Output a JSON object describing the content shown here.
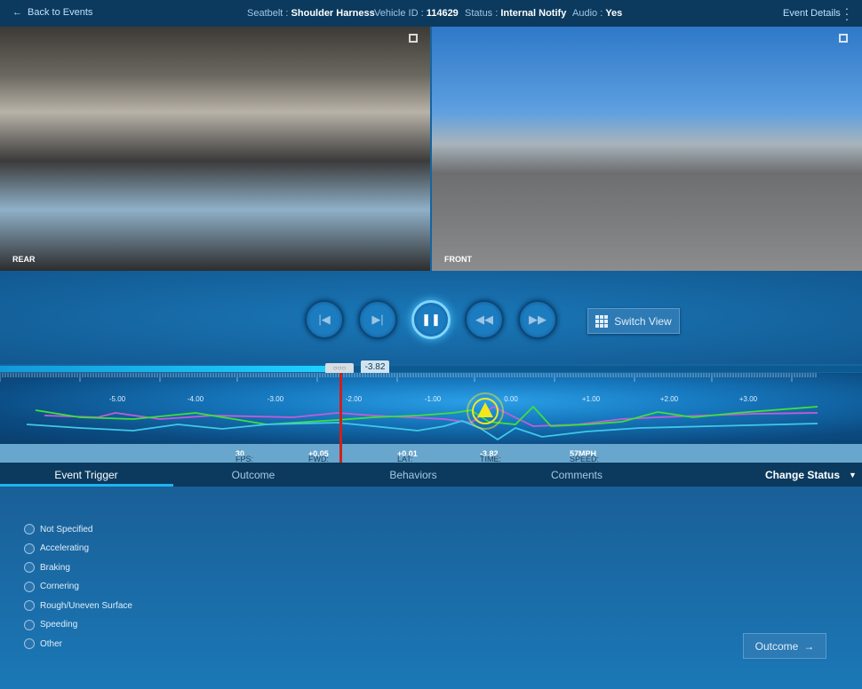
{
  "header": {
    "back_label": "Back to Events",
    "seatbelt_label": "Seatbelt :",
    "seatbelt_value": "Shoulder Harness",
    "vehicle_label": "Vehicle ID :",
    "vehicle_value": "114629",
    "status_label": "Status :",
    "status_value": "Internal Notify",
    "audio_label": "Audio :",
    "audio_value": "Yes",
    "details_label": "Event Details"
  },
  "videos": {
    "rear_label": "REAR",
    "front_label": "FRONT"
  },
  "controls": {
    "buttons": [
      "skip-back",
      "step-forward",
      "pause",
      "rewind",
      "fast-forward"
    ],
    "switch_view_label": "Switch View"
  },
  "timeline": {
    "progress_percent": 38,
    "thumb_label": "○○○",
    "current_time": "-3.82",
    "ticks": [
      "-5.00",
      "-4.00",
      "-3.00",
      "-2.00",
      "-1.00",
      "0.00",
      "+1.00",
      "+2.00",
      "+3.00"
    ],
    "series_colors": [
      "#c45cd8",
      "#3ee03a",
      "#3fc8e8"
    ],
    "playhead_color": "#d0201a",
    "event_marker_color": "#f2e81c"
  },
  "stats": {
    "fps_label": "FPS:",
    "fps": "30",
    "fwd_label": "FWD:",
    "fwd": "+0.05",
    "lat_label": "LAT:",
    "lat": "+0.01",
    "time_label": "TIME:",
    "time": "-3.82",
    "speed_label": "SPEED:",
    "speed": "57MPH"
  },
  "tabs": {
    "items": [
      "Event Trigger",
      "Outcome",
      "Behaviors",
      "Comments"
    ],
    "active": "Event Trigger",
    "change_status": "Change Status"
  },
  "triggers": [
    "Not Specified",
    "Accelerating",
    "Braking",
    "Cornering",
    "Rough/Uneven Surface",
    "Speeding",
    "Other"
  ],
  "outcome_button": "Outcome"
}
